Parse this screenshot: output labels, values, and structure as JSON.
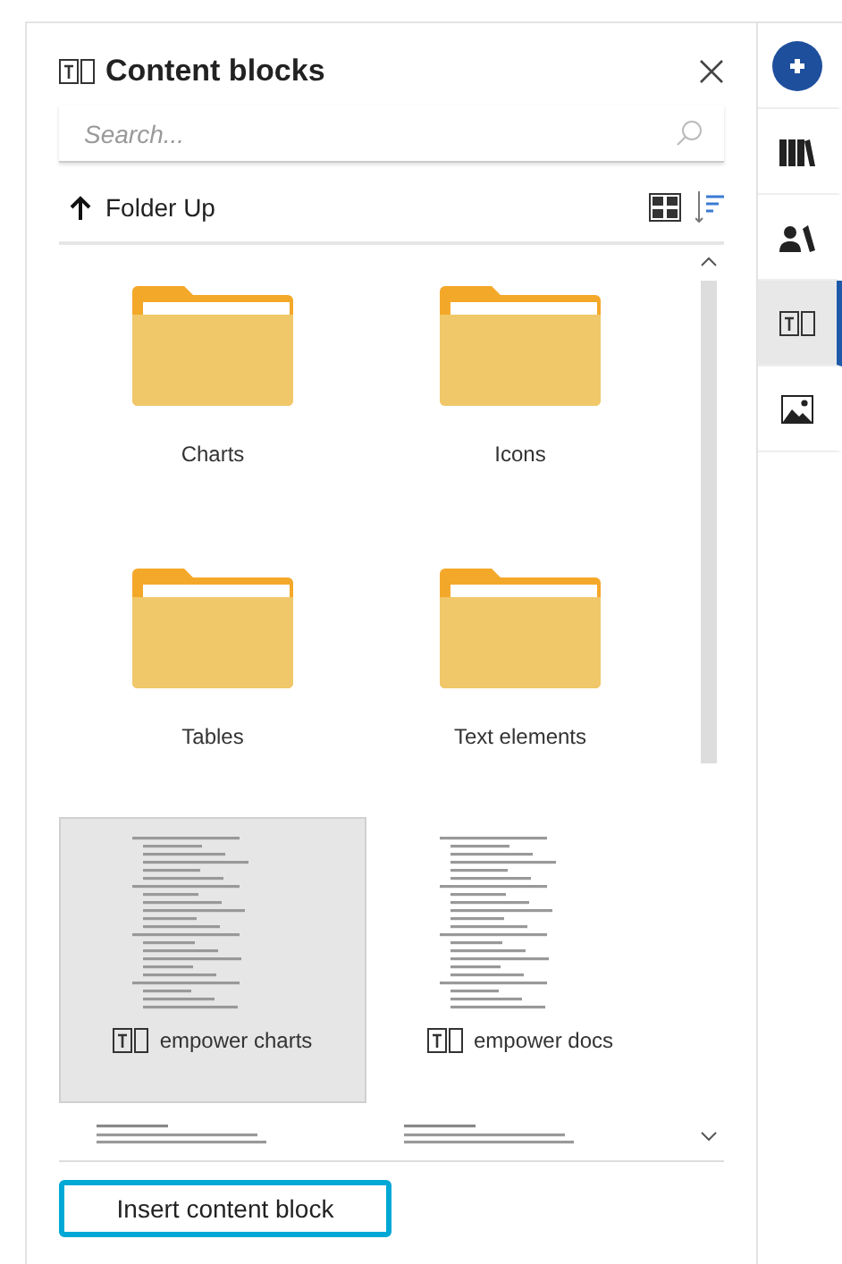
{
  "panel": {
    "title": "Content blocks",
    "search": {
      "placeholder": "Search..."
    },
    "folder_up": "Folder Up"
  },
  "items": [
    {
      "kind": "folder",
      "label": "Charts",
      "selected": false
    },
    {
      "kind": "folder",
      "label": "Icons",
      "selected": false
    },
    {
      "kind": "folder",
      "label": "Tables",
      "selected": false
    },
    {
      "kind": "folder",
      "label": "Text elements",
      "selected": false
    },
    {
      "kind": "block",
      "label": "empower charts",
      "selected": true
    },
    {
      "kind": "block",
      "label": "empower docs",
      "selected": false
    },
    {
      "kind": "partial"
    },
    {
      "kind": "partial"
    }
  ],
  "insert_button": "Insert content block",
  "rail": [
    {
      "kind": "logo",
      "selected": false
    },
    {
      "kind": "library",
      "selected": false
    },
    {
      "kind": "people",
      "selected": false
    },
    {
      "kind": "blocks",
      "selected": true
    },
    {
      "kind": "image",
      "selected": false
    }
  ]
}
